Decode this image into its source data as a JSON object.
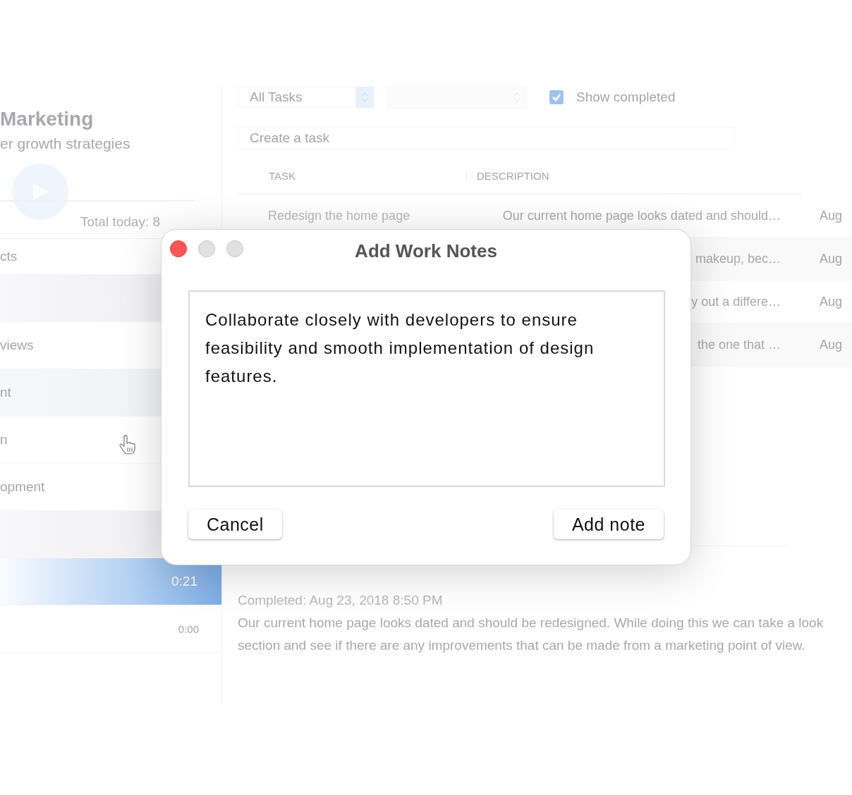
{
  "sidebar": {
    "title": "Marketing",
    "subtitle": "er growth strategies",
    "total": "Total today: 8",
    "items": [
      {
        "label": "cts",
        "kind": "plain"
      },
      {
        "kind": "shaded"
      },
      {
        "label": "views",
        "kind": "plain"
      },
      {
        "label": "nt",
        "kind": "hover"
      },
      {
        "label": "n",
        "kind": "plain"
      },
      {
        "label": "opment",
        "kind": "plain"
      },
      {
        "kind": "shaded"
      },
      {
        "label": "0:21",
        "kind": "active"
      },
      {
        "label": "0:00",
        "kind": "timer"
      }
    ]
  },
  "toolbar": {
    "filter": "All Tasks",
    "show_completed": {
      "label": "Show completed",
      "checked": true
    },
    "create_placeholder": "Create a task"
  },
  "table": {
    "columns": [
      "TASK",
      "DESCRIPTION"
    ],
    "rows": [
      {
        "task": "Redesign the home page",
        "description": "Our current home page looks dated and should…",
        "date": "Aug"
      },
      {
        "description": "makeup, bec…",
        "date": "Aug"
      },
      {
        "description": "y out a differe…",
        "date": "Aug"
      },
      {
        "description": "the one that …",
        "date": "Aug"
      }
    ]
  },
  "detail": {
    "completed": "Completed: Aug 23, 2018 8:50 PM",
    "lines": [
      "Our current home page looks dated and should be redesigned. While doing this we can take a look",
      "section and see if there are any improvements that can be made from a marketing point of view."
    ]
  },
  "dialog": {
    "title": "Add Work Notes",
    "note": "Collaborate closely with developers to ensure feasibility and smooth implementation of design features.",
    "buttons": [
      "Cancel",
      "Add note"
    ]
  }
}
